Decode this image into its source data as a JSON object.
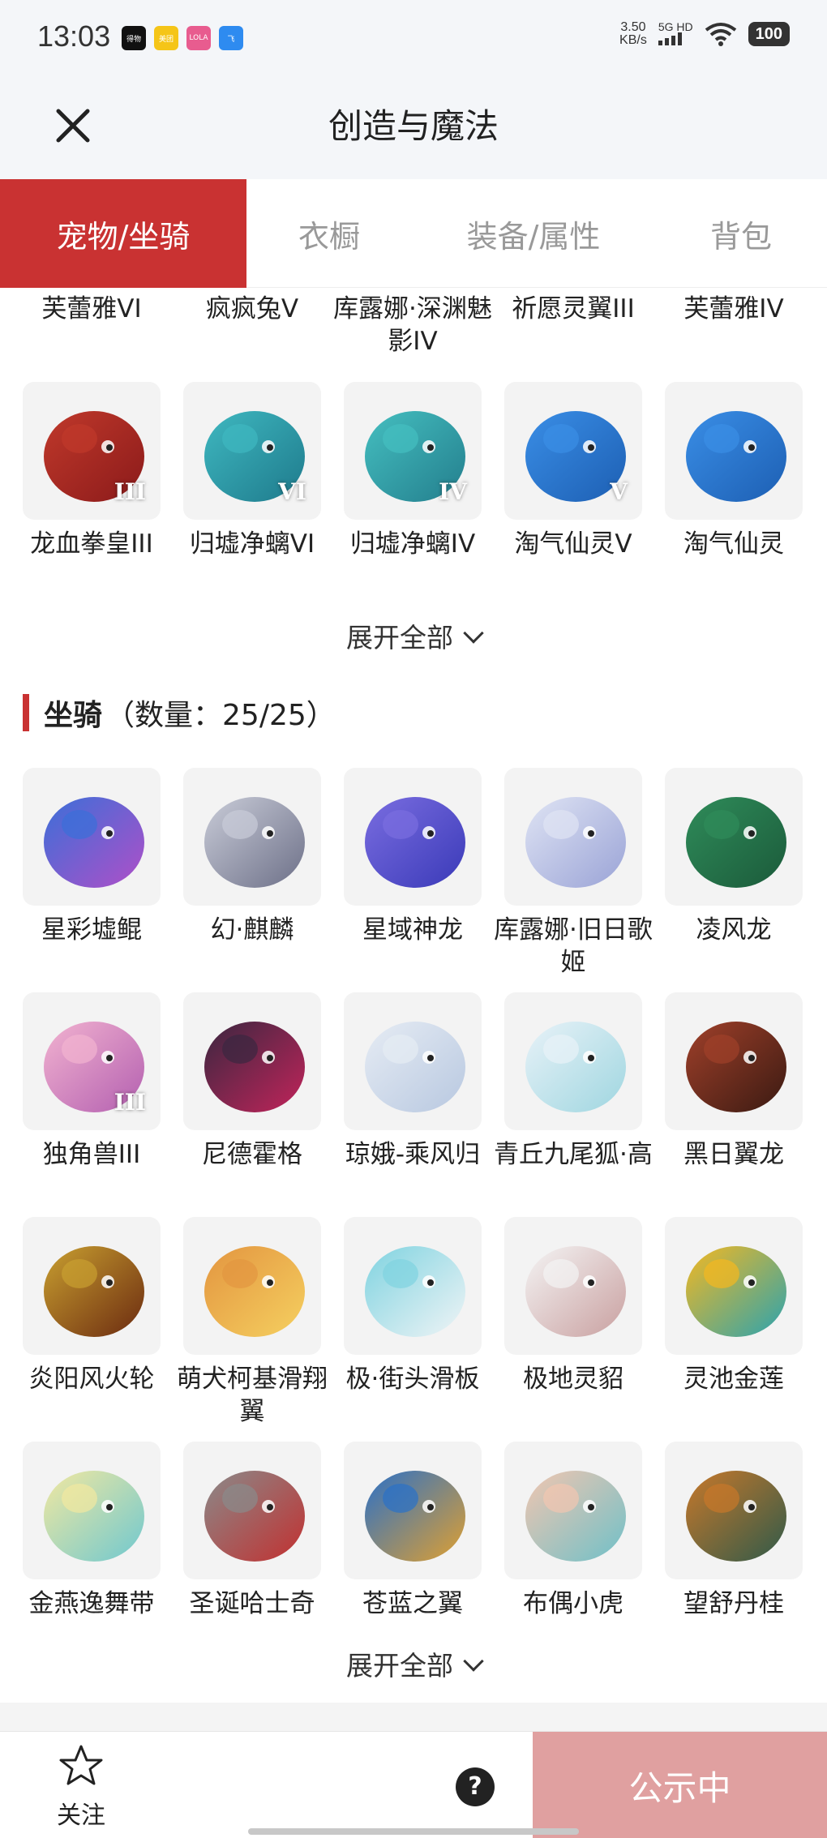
{
  "status_bar": {
    "time": "13:03",
    "apps": [
      {
        "label": "得物",
        "color": "#111111"
      },
      {
        "label": "美团",
        "color": "#f5c518"
      },
      {
        "label": "LOLA",
        "color": "#e85c8f"
      },
      {
        "label": "飞",
        "color": "#2e8bf0"
      }
    ],
    "net_speed": "3.50",
    "net_unit": "KB/s",
    "signal": "5G HD",
    "battery": "100"
  },
  "header": {
    "title": "创造与魔法"
  },
  "tabs": [
    {
      "label": "宠物/坐骑",
      "active": true
    },
    {
      "label": "衣橱",
      "active": false
    },
    {
      "label": "装备/属性",
      "active": false
    },
    {
      "label": "背包",
      "active": false
    }
  ],
  "pets_partial": {
    "top_names": [
      "芙蕾雅VI",
      "疯疯兔V",
      "库露娜·深渊魅影IV",
      "祈愿灵翼III",
      "芙蕾雅IV"
    ],
    "row": [
      {
        "name": "龙血拳皇III",
        "badge": "III",
        "color": "#c0392b",
        "color2": "#8b1a1a"
      },
      {
        "name": "归墟净螭VI",
        "badge": "VI",
        "color": "#3fb8c0",
        "color2": "#1e7a8c"
      },
      {
        "name": "归墟净螭IV",
        "badge": "IV",
        "color": "#45bfc0",
        "color2": "#237e8d"
      },
      {
        "name": "淘气仙灵V",
        "badge": "V",
        "color": "#3a8ee6",
        "color2": "#1d5fb3"
      },
      {
        "name": "淘气仙灵",
        "badge": "",
        "color": "#3a8ee6",
        "color2": "#1d5fb3"
      }
    ],
    "expand_label": "展开全部"
  },
  "mounts": {
    "title": "坐骑",
    "count": "（数量：25/25）",
    "items": [
      {
        "name": "星彩墟鲲",
        "badge": "",
        "color": "#3b6fd8",
        "color2": "#b04fc8"
      },
      {
        "name": "幻·麒麟",
        "badge": "",
        "color": "#c9ccd8",
        "color2": "#6d7088"
      },
      {
        "name": "星域神龙",
        "badge": "",
        "color": "#7a6de0",
        "color2": "#3a3ab8"
      },
      {
        "name": "库露娜·旧日歌姬",
        "badge": "",
        "color": "#dfe4f4",
        "color2": "#9aa3d6"
      },
      {
        "name": "凌风龙",
        "badge": "",
        "color": "#2f8c5a",
        "color2": "#1b5a3a"
      },
      {
        "name": "独角兽III",
        "badge": "III",
        "color": "#f2b3d0",
        "color2": "#b35fb0"
      },
      {
        "name": "尼德霍格",
        "badge": "",
        "color": "#3a2740",
        "color2": "#c2245a"
      },
      {
        "name": "琼娥-乘风归",
        "badge": "",
        "color": "#e6ecf4",
        "color2": "#b8c8e0"
      },
      {
        "name": "青丘九尾狐·高",
        "badge": "",
        "color": "#e8f2f8",
        "color2": "#9fd6e0"
      },
      {
        "name": "黑日翼龙",
        "badge": "",
        "color": "#a0402a",
        "color2": "#3a1a12"
      },
      {
        "name": "炎阳风火轮",
        "badge": "",
        "color": "#c9a030",
        "color2": "#6b2a10"
      },
      {
        "name": "萌犬柯基滑翔翼",
        "badge": "",
        "color": "#e39540",
        "color2": "#f5d060"
      },
      {
        "name": "极·街头滑板",
        "badge": "",
        "color": "#7fd3e0",
        "color2": "#f0f4f6"
      },
      {
        "name": "极地灵貂",
        "badge": "",
        "color": "#f4f4f4",
        "color2": "#c9a0a0"
      },
      {
        "name": "灵池金莲",
        "badge": "",
        "color": "#f5b820",
        "color2": "#2aa3b0"
      },
      {
        "name": "金燕逸舞带",
        "badge": "",
        "color": "#f2e8a0",
        "color2": "#6fc8d0"
      },
      {
        "name": "圣诞哈士奇",
        "badge": "",
        "color": "#8a8a8a",
        "color2": "#c23030"
      },
      {
        "name": "苍蓝之翼",
        "badge": "",
        "color": "#2a70c8",
        "color2": "#e0a030"
      },
      {
        "name": "布偶小虎",
        "badge": "",
        "color": "#f2c6b0",
        "color2": "#6fc0c8"
      },
      {
        "name": "望舒丹桂",
        "badge": "",
        "color": "#c8782a",
        "color2": "#2f5a4a"
      }
    ],
    "expand_label": "展开全部"
  },
  "bottom_bar": {
    "follow_label": "关注",
    "help_label": "?",
    "publicize_label": "公示中"
  }
}
